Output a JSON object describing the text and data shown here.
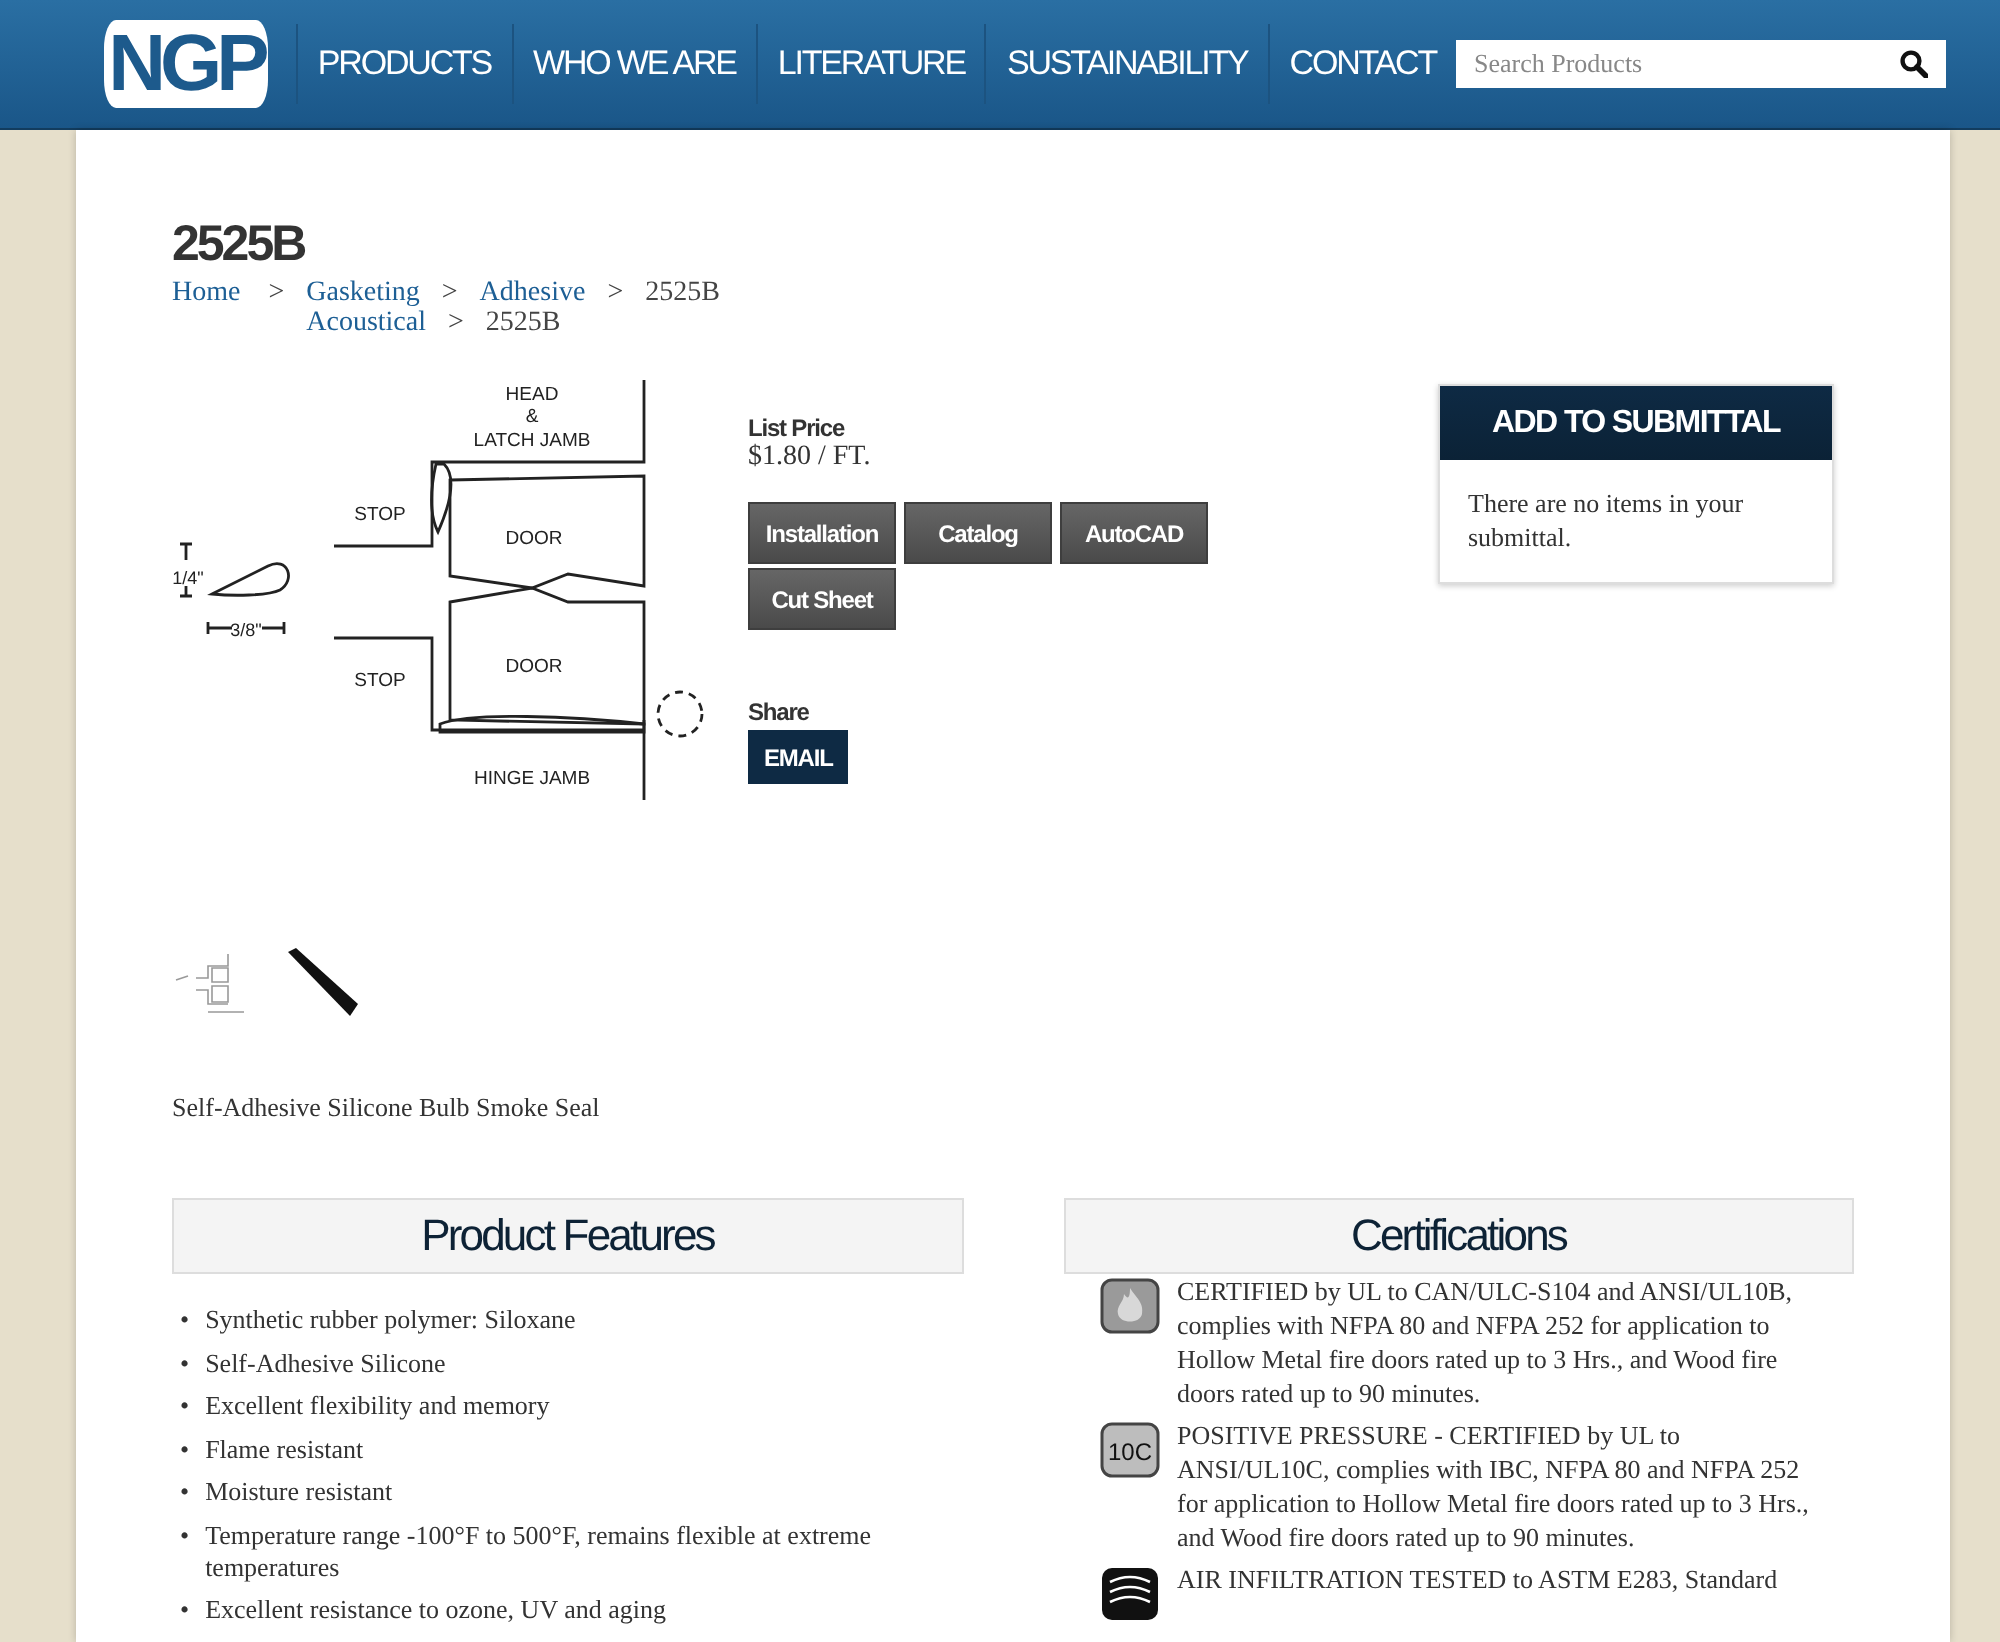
{
  "header": {
    "logo": "NGP",
    "nav": [
      {
        "label": "PRODUCTS"
      },
      {
        "label": "WHO WE ARE"
      },
      {
        "label": "LITERATURE"
      },
      {
        "label": "SUSTAINABILITY"
      },
      {
        "label": "CONTACT"
      }
    ],
    "search": {
      "placeholder": "Search Products"
    }
  },
  "product": {
    "title": "2525B",
    "breadcrumb": {
      "root": "Home",
      "separator": ">",
      "trails": [
        [
          "Gasketing",
          "Adhesive",
          "2525B"
        ],
        [
          "Acoustical",
          "2525B"
        ]
      ]
    },
    "diagram": {
      "labels": [
        "HEAD",
        "&",
        "LATCH JAMB",
        "STOP",
        "DOOR",
        "DOOR",
        "STOP",
        "HINGE JAMB",
        "1/4\"",
        "3/8\""
      ]
    },
    "price": {
      "label": "List Price",
      "value": "$1.80 / FT."
    },
    "documents": [
      "Installation",
      "Catalog",
      "AutoCAD",
      "Cut Sheet"
    ],
    "share": {
      "label": "Share",
      "button": "EMAIL"
    },
    "description": "Self-Adhesive Silicone Bulb Smoke Seal"
  },
  "submittal": {
    "title": "ADD TO SUBMITTAL",
    "message": "There are no items in your submittal."
  },
  "features": {
    "title": "Product Features",
    "marker": "•",
    "items": [
      "Synthetic rubber polymer: Siloxane",
      "Self-Adhesive Silicone",
      "Excellent flexibility and memory",
      "Flame resistant",
      "Moisture resistant",
      "Temperature range -100°F to 500°F, remains flexible at extreme temperatures",
      "Excellent resistance to ozone, UV and aging"
    ]
  },
  "certifications": {
    "title": "Certifications",
    "items": [
      {
        "kind": "fire",
        "text": "CERTIFIED by UL to CAN/ULC-S104 and ANSI/UL10B, complies with NFPA 80 and NFPA 252 for application to Hollow Metal fire doors rated up to 3 Hrs., and Wood fire doors rated up to 90 minutes."
      },
      {
        "kind": "badge",
        "badge": "10C",
        "text": "POSITIVE PRESSURE - CERTIFIED by UL to ANSI/UL10C, complies with IBC, NFPA 80 and NFPA 252 for application to Hollow Metal fire doors rated up to 3 Hrs., and Wood fire doors rated up to 90 minutes."
      },
      {
        "kind": "air",
        "text": "AIR INFILTRATION TESTED to ASTM E283, Standard"
      }
    ]
  }
}
